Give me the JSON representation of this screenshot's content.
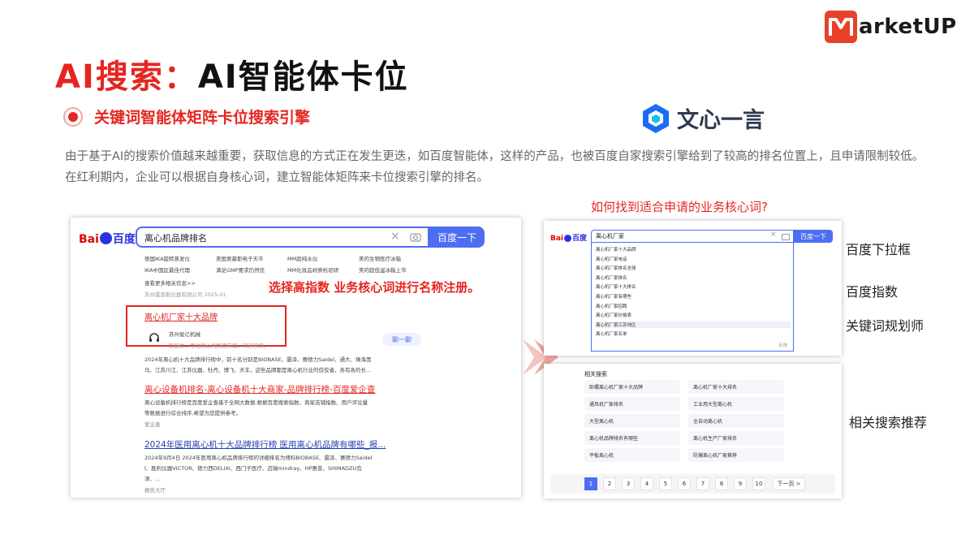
{
  "brand": {
    "logo_word": "arketUP"
  },
  "title": {
    "red": "AI搜索：",
    "black": "AI智能体卡位"
  },
  "subtitle": "关键词智能体矩阵卡位搜索引擎",
  "wenxin": {
    "name": "文心一言"
  },
  "description": "由于基于AI的搜索价值越来越重要，获取信息的方式正在发生更迭，如百度智能体，这样的产品，也被百度自家搜索引擎给到了较高的排名位置上，且申请限制较低。在红利期内，企业可以根据自身核心词，建立智能体矩阵来卡位搜索引擎的排名。",
  "question": "如何找到适合申请的业务核心词?",
  "left_panel": {
    "baidu_logo": {
      "bai": "Bai",
      "du": "百度"
    },
    "query": "离心机品牌排名",
    "search_button": "百度一下",
    "related_links": [
      [
        "德国IKA旋转蒸发仪",
        "美国奥豪斯电子天平",
        "MM超纯水仪",
        "美的生物医疗冰箱"
      ],
      [
        "IKA中国区最佳代理",
        "满足GMP要求仍然优",
        "MM化妆品材质检验研",
        "美的超低温冰箱上市"
      ]
    ],
    "more_link": "查看更多相关信息>>",
    "source_line": "苏州雷恩斯仪器有限公司 2025-01",
    "annotation": "选择高指数 业务核心词进行名称注册。",
    "boxed_result": "离心机厂家十大品牌",
    "agent_name": "苏州星亿机械",
    "agent_desc": "智能体，专注离心机制造方案，欢迎咨询。",
    "chat_button": "聊一聊",
    "result1_lines": [
      "2024年离心机十大品牌排行榜中，前十名分别是BIOBASE、震泽、赛德力Saidel、通大、珠海黑",
      "马、江苏川江、江苏仪器、牡丹、博飞、天丰，这些品牌都是离心机行业的佼佼者，各有各的长..."
    ],
    "result2_title": "离心设备机排名-离心设备机十大商家-品牌排行榜-百度爱企查",
    "result2_lines": [
      "离心设备机排行榜是百度爱企查基于全网大数据,根据百度搜索指数、商家店铺指数、用户评论量",
      "等数据进行综合排序,希望为您提供参考。"
    ],
    "result2_source": "爱企查",
    "result3_title": "2024年医用离心机十大品牌排行榜 医用离心机品牌有哪些_报...",
    "result3_lines": [
      "2024年9月4日 2024年医用离心机品牌排行榜的详细排名为傅科BIOBASE、震泽、赛德力Saidel",
      "l、胜利仪器VICTOR、德力西DELIXI、西门子医疗、迈瑞mindray、HP惠普、SHIMADZU岛",
      "津、..."
    ],
    "result3_source": "报告大厅"
  },
  "dropdown_panel": {
    "query": "离心机厂家",
    "search_button": "百度一下",
    "suggestions": [
      "离心机厂家十大品牌",
      "离心机厂家电话",
      "离心机厂家排名全球",
      "离心机厂家排名",
      "离心机厂家十大排名",
      "离心机厂家有哪些",
      "离心机厂家招聘",
      "离心机厂家价格表",
      "离心机厂家江苏地区",
      "离心机厂家名单"
    ],
    "tail": "反馈"
  },
  "related_panel": {
    "heading": "相关搜索",
    "items": [
      "卧螺离心机厂家十大品牌",
      "离心机厂家十大排名",
      "通风机厂家排名",
      "工业用大型离心机",
      "大型离心机",
      "全自动离心机",
      "离心机品牌排名有哪些",
      "离心机生产厂家排名",
      "平板离心机",
      "防爆离心机厂家推荐"
    ],
    "pages": [
      "1",
      "2",
      "3",
      "4",
      "5",
      "6",
      "7",
      "8",
      "9",
      "10"
    ],
    "next": "下一页 >"
  },
  "labels": {
    "dropdown": "百度下拉框",
    "index": "百度指数",
    "planner": "关键词规划师",
    "related": "相关搜索推荐"
  },
  "colors": {
    "accent_red": "#e52620",
    "baidu_blue": "#4e6ef2",
    "link_blue": "#2440b3"
  },
  "icons": [
    "marketup-logo-icon",
    "radio-dot-icon",
    "wenxin-cube-icon",
    "clear-icon",
    "camera-icon",
    "headset-icon",
    "arrow-right-icon"
  ]
}
